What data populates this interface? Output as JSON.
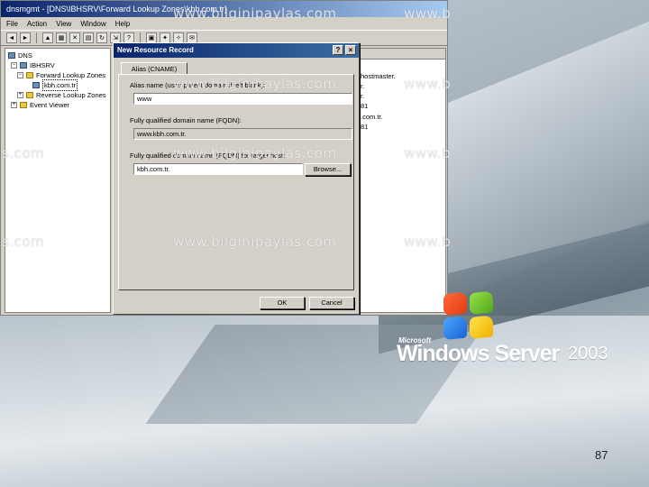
{
  "mmc": {
    "title": "dnsmgmt - [DNS\\IBHSRV\\Forward Lookup Zones\\kbh.com.tr]",
    "menu": [
      "File",
      "Action",
      "View",
      "Window",
      "Help"
    ]
  },
  "tree": {
    "root": "DNS",
    "server": "IBHSRV",
    "forward_zones": "Forward Lookup Zones",
    "zone": "kbh.com.tr",
    "reverse_zones": "Reverse Lookup Zones",
    "event_viewer": "Event Viewer"
  },
  "right_pane_fragments": [
    "hostmaster.",
    "r.",
    "r.",
    "81",
    ".com.tr.",
    "81"
  ],
  "dialog": {
    "title": "New Resource Record",
    "help_button": "?",
    "close_button": "×",
    "tab_label": "Alias (CNAME)",
    "alias_label": "Alias name (uses parent domain if left blank):",
    "alias_value": "www",
    "fqdn_label": "Fully qualified domain name (FQDN):",
    "fqdn_value": "www.kbh.com.tr.",
    "target_label": "Fully qualified domain name (FQDN) for target host:",
    "target_value": "kbh.com.tr.",
    "browse_button": "Browse...",
    "ok_button": "OK",
    "cancel_button": "Cancel"
  },
  "watermark": {
    "text": "www.bilginipaylas.com",
    "partial_right": "www.b",
    "partial_left": "s.com"
  },
  "logo": {
    "maker": "Microsoft",
    "product": "Windows Server",
    "version": "2003"
  },
  "page_number": "87"
}
